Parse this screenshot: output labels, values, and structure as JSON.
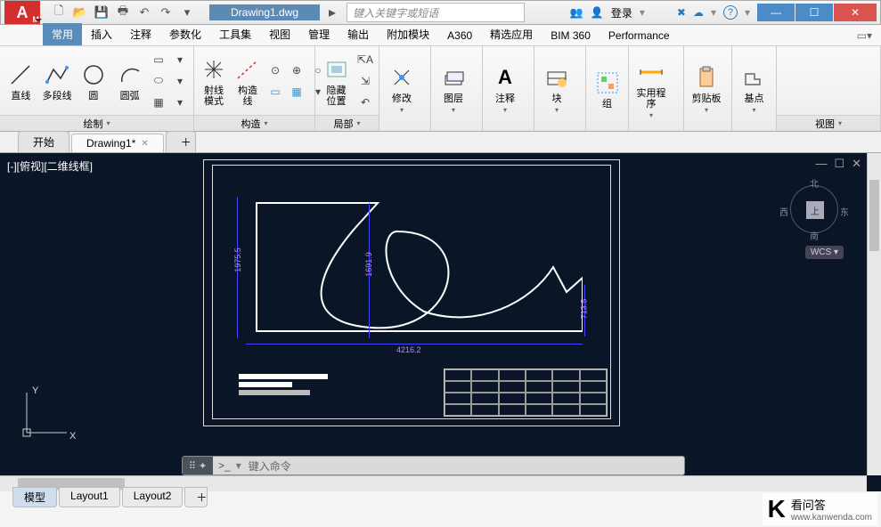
{
  "window": {
    "doc_title": "Drawing1.dwg",
    "search_placeholder": "键入关键字或短语",
    "login_label": "登录"
  },
  "ribbon_tabs": [
    "常用",
    "插入",
    "注释",
    "参数化",
    "工具集",
    "视图",
    "管理",
    "输出",
    "附加模块",
    "A360",
    "精选应用",
    "BIM 360",
    "Performance"
  ],
  "ribbon_active": 0,
  "panels": {
    "draw": {
      "label": "绘制",
      "btns": {
        "line": "直线",
        "polyline": "多段线",
        "circle": "圆",
        "arc": "圆弧"
      }
    },
    "construct": {
      "label": "构造",
      "btns": {
        "ray": "射线\n模式",
        "cline": "构造\n线"
      }
    },
    "local": {
      "label": "局部",
      "btns": {
        "hide": "隐藏\n位置"
      }
    },
    "modify": {
      "label": "修改"
    },
    "layers": {
      "label": "图层"
    },
    "annotate": {
      "label": "注释"
    },
    "block": {
      "label": "块"
    },
    "group": {
      "label": "组"
    },
    "utils": {
      "label": "实用程序"
    },
    "clipboard": {
      "label": "剪贴板"
    },
    "basepoint": {
      "label": "基点"
    },
    "view": {
      "label": "视图"
    }
  },
  "file_tabs": {
    "start": "开始",
    "drawing": "Drawing1*"
  },
  "viewport": {
    "label": "[-][俯视][二维线框]",
    "dims": {
      "left": "1975.5",
      "mid": "1691.9",
      "right": "713.5",
      "bottom": "4216.2"
    },
    "compass": {
      "n": "北",
      "e": "东",
      "s": "南",
      "w": "西",
      "top": "上"
    },
    "wcs": "WCS",
    "ucs_y": "Y",
    "ucs_x": "X"
  },
  "cmd": {
    "placeholder": "键入命令"
  },
  "layout_tabs": [
    "模型",
    "Layout1",
    "Layout2"
  ],
  "status_letter": "M",
  "watermark": {
    "name": "看问答",
    "url": "www.kanwenda.com"
  }
}
